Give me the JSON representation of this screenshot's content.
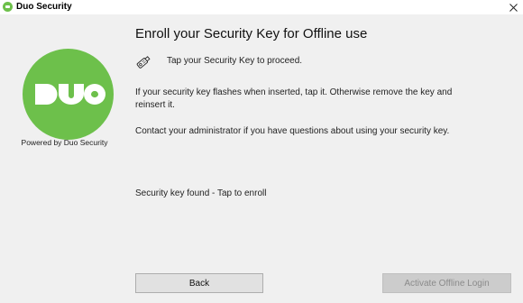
{
  "window": {
    "title": "Duo Security",
    "close_icon": "close-icon",
    "app_icon": "duo-app-icon"
  },
  "sidebar": {
    "logo_icon": "duo-logo-icon",
    "powered_by": "Powered by Duo Security"
  },
  "main": {
    "heading": "Enroll your Security Key for Offline use",
    "key_icon": "security-key-icon",
    "tap_instruction": "Tap your Security Key to proceed.",
    "paragraph1": "If your security key flashes when inserted, tap it. Otherwise remove the key and reinsert it.",
    "paragraph2": "Contact your administrator if you have questions about using your security key.",
    "status": "Security key found - Tap to enroll"
  },
  "buttons": {
    "back": "Back",
    "activate": "Activate Offline Login",
    "activate_enabled": false
  },
  "colors": {
    "brand_green": "#6dc04b",
    "window_bg": "#f0f0f0",
    "titlebar_bg": "#ffffff"
  }
}
